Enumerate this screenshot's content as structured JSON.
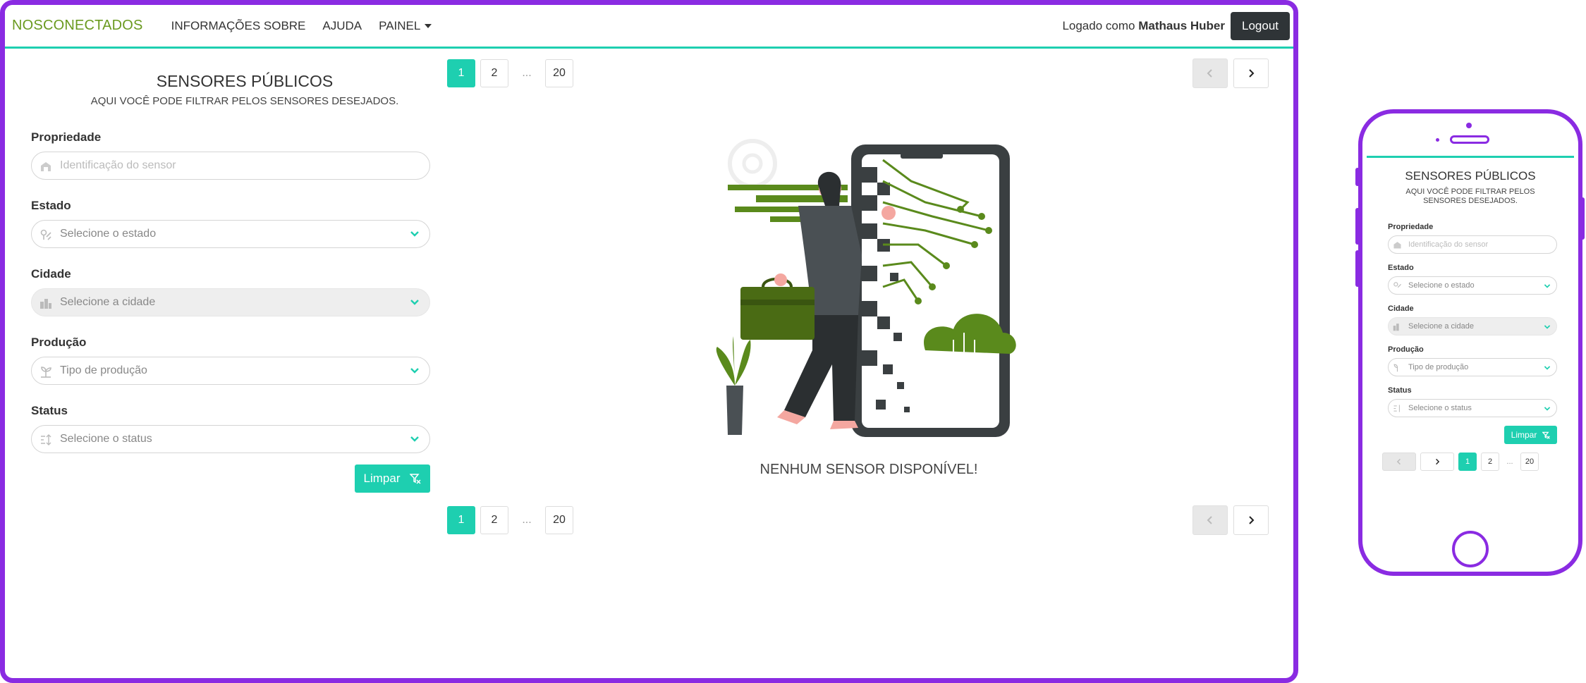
{
  "navbar": {
    "brand": "NOSCONECTADOS",
    "links": [
      "INFORMAÇÕES SOBRE",
      "AJUDA",
      "PAINEL"
    ],
    "logged_as": "Logado como",
    "user_name": "Mathaus Huber",
    "logout_label": "Logout"
  },
  "filters": {
    "title": "SENSORES PÚBLICOS",
    "subtitle": "AQUI VOCÊ PODE FILTRAR PELOS SENSORES DESEJADOS.",
    "property_label": "Propriedade",
    "property_placeholder": "Identificação do sensor",
    "state_label": "Estado",
    "state_value": "Selecione o estado",
    "city_label": "Cidade",
    "city_value": "Selecione a cidade",
    "production_label": "Produção",
    "production_value": "Tipo de produção",
    "status_label": "Status",
    "status_value": "Selecione o status",
    "clear_label": "Limpar"
  },
  "pagination": {
    "pages": [
      "1",
      "2",
      "20"
    ],
    "ellipsis": "...",
    "current": "1"
  },
  "empty_message": "NENHUM SENSOR DISPONÍVEL!",
  "colors": {
    "accent": "#1ecfb0",
    "brand": "#6a9a1f",
    "frame": "#8a2be2",
    "logout_bg": "#2f3437"
  },
  "icons": [
    "barn-icon",
    "map-pin-icon",
    "city-icon",
    "sprout-icon",
    "status-icon",
    "chevron-down-icon",
    "filter-clear-icon",
    "chevron-left-icon",
    "chevron-right-icon"
  ]
}
